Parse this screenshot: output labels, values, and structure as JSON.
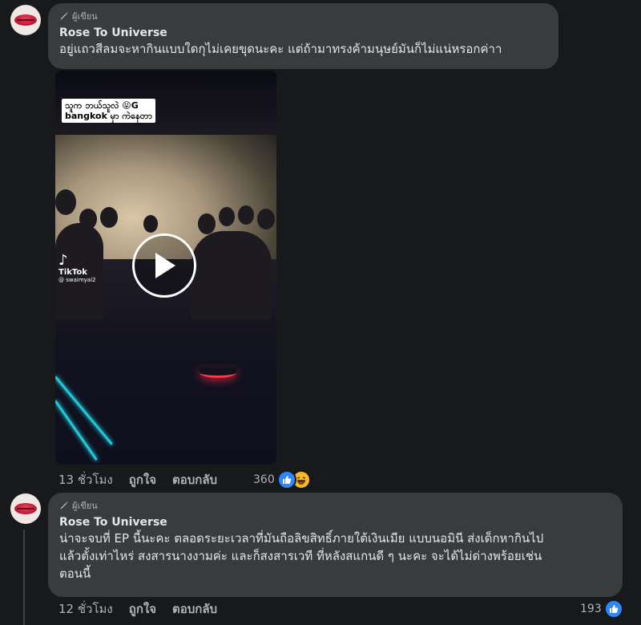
{
  "colors": {
    "bubble": "#3a3b3c",
    "background": "#18191a",
    "like_blue": "#2d88ff"
  },
  "comments": [
    {
      "badge": "ผู้เขียน",
      "author": "Rose To Universe",
      "text": "อยู่แถวสีลมจะหากินแบบใดกุไม่เคยขุดนะคะ แต่ถ้ามาทรงค้ามนุษย์มันก็ไม่แน่หรอกค่าา",
      "time": "13 ชั่วโมง",
      "like_label": "ถูกใจ",
      "reply_label": "ตอบกลับ",
      "reaction_count": "360",
      "reaction_icons": [
        "like-icon",
        "haha-icon"
      ],
      "video": {
        "caption_line1": "သူက ဘယ်သူလဲ 😝G",
        "caption_line2": "bangkok မှာ ကဲနေတာ",
        "watermark": "TikTok",
        "handle": "@ swaimyai2"
      }
    },
    {
      "badge": "ผู้เขียน",
      "author": "Rose To Universe",
      "text": "น่าจะจบที่ EP นี้นะคะ ตลอดระยะเวลาที่มันถือลิขสิทธิ์ภายใต้เงินเมีย แบบนอมินี ส่งเด็กหากินไป\nแล้วตั้งเท่าไหร่ สงสารนางงามค่ะ และก็สงสารเวที ที่หลังสแกนดี ๆ นะคะ จะได้ไม่ด่างพร้อยเช่น\nตอนนี้",
      "time": "12 ชั่วโมง",
      "like_label": "ถูกใจ",
      "reply_label": "ตอบกลับ",
      "reaction_count": "193",
      "reaction_icons": [
        "like-icon"
      ]
    }
  ]
}
